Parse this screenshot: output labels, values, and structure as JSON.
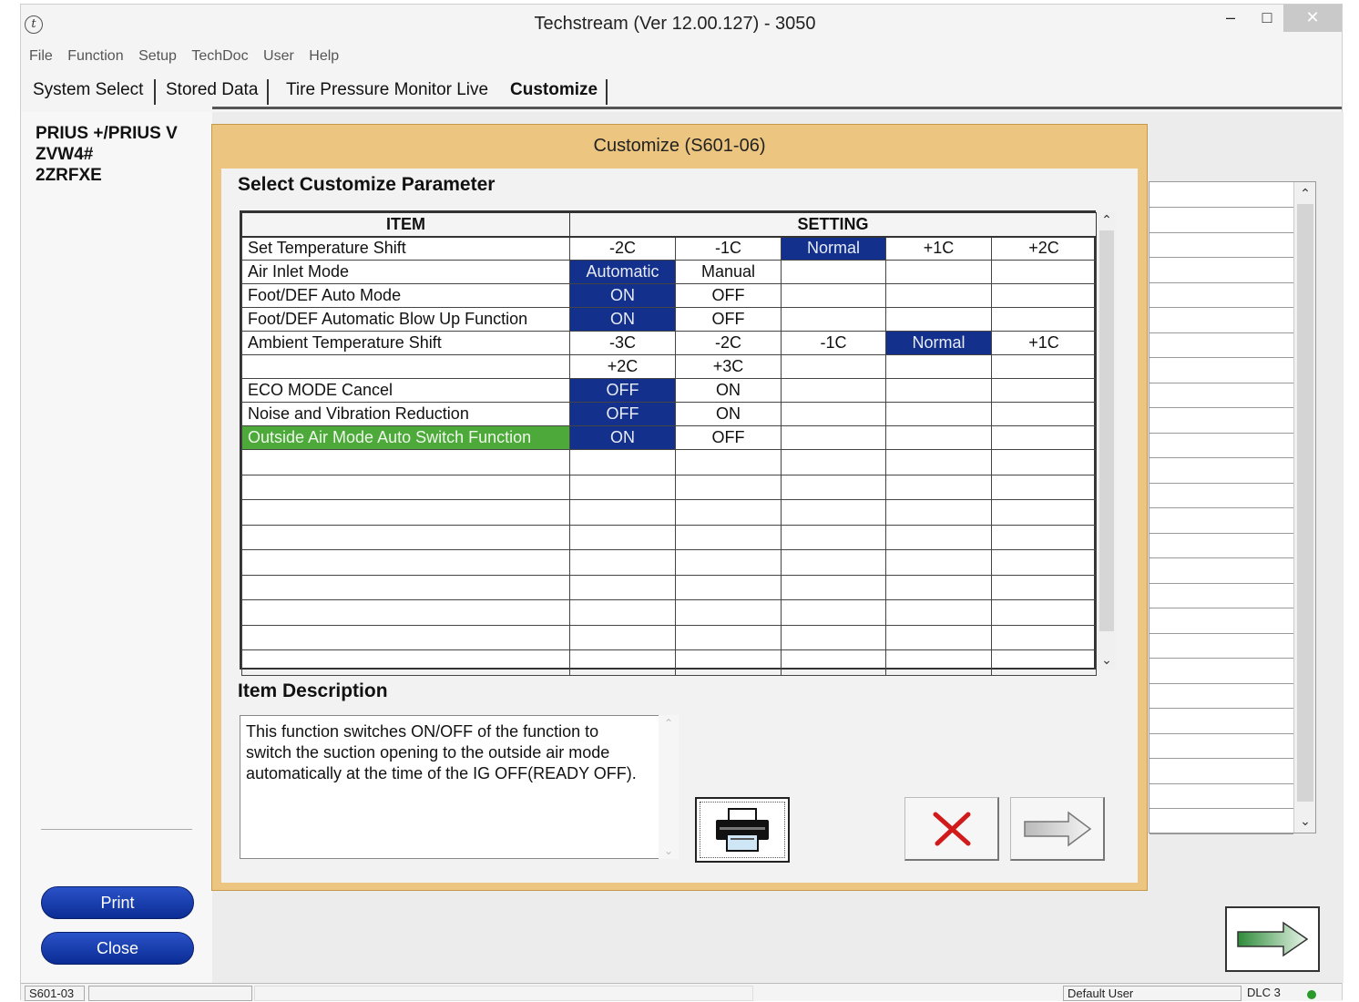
{
  "window": {
    "title": "Techstream (Ver 12.00.127) - 3050",
    "app_icon": "t",
    "controls": {
      "minimize": "–",
      "maximize": "□",
      "close": "✕"
    }
  },
  "menu": [
    "File",
    "Function",
    "Setup",
    "TechDoc",
    "User",
    "Help"
  ],
  "tabs": [
    {
      "label": "System Select",
      "active": false
    },
    {
      "label": "Stored Data",
      "active": false
    },
    {
      "label": "Tire Pressure Monitor Live",
      "active": false
    },
    {
      "label": "Customize",
      "active": true
    }
  ],
  "vehicle": {
    "model": "PRIUS +/PRIUS V",
    "code": "ZVW4#",
    "engine": "2ZRFXE"
  },
  "left_buttons": {
    "print": "Print",
    "close": "Close"
  },
  "dialog": {
    "title": "Customize (S601-06)",
    "section_title": "Select Customize Parameter",
    "headers": {
      "item": "ITEM",
      "setting": "SETTING"
    },
    "rows": [
      {
        "item": "Set Temperature Shift",
        "options": [
          "-2C",
          "-1C",
          "Normal",
          "+1C",
          "+2C"
        ],
        "selected": 2
      },
      {
        "item": "Air Inlet Mode",
        "options": [
          "Automatic",
          "Manual",
          "",
          "",
          ""
        ],
        "selected": 0
      },
      {
        "item": "Foot/DEF Auto Mode",
        "options": [
          "ON",
          "OFF",
          "",
          "",
          ""
        ],
        "selected": 0
      },
      {
        "item": "Foot/DEF Automatic Blow Up Function",
        "options": [
          "ON",
          "OFF",
          "",
          "",
          ""
        ],
        "selected": 0
      },
      {
        "item": "Ambient Temperature Shift",
        "options": [
          "-3C",
          "-2C",
          "-1C",
          "Normal",
          "+1C"
        ],
        "selected": 3
      },
      {
        "item": "",
        "options": [
          "+2C",
          "+3C",
          "",
          "",
          ""
        ],
        "selected": -1
      },
      {
        "item": "ECO MODE Cancel",
        "options": [
          "OFF",
          "ON",
          "",
          "",
          ""
        ],
        "selected": 0
      },
      {
        "item": "Noise and Vibration Reduction",
        "options": [
          "OFF",
          "ON",
          "",
          "",
          ""
        ],
        "selected": 0
      },
      {
        "item": "Outside Air Mode Auto Switch Function",
        "options": [
          "ON",
          "OFF",
          "",
          "",
          ""
        ],
        "selected": 0,
        "row_selected": true
      }
    ],
    "description_title": "Item Description",
    "description": "This function switches ON/OFF of the function to switch the suction opening to the outside air mode automatically at the time of the IG OFF(READY OFF).",
    "buttons": {
      "print_icon": "printer-icon",
      "cancel_icon": "cancel-x-icon",
      "next_icon": "arrow-right-icon"
    }
  },
  "statusbar": {
    "screen_id": "S601-03",
    "user": "Default User",
    "connection": "DLC 3"
  },
  "colors": {
    "selected_cell": "#12308c",
    "selected_row": "#4ca93a",
    "dialog_frame": "#ecc680",
    "button_blue": "#0a2c94"
  }
}
